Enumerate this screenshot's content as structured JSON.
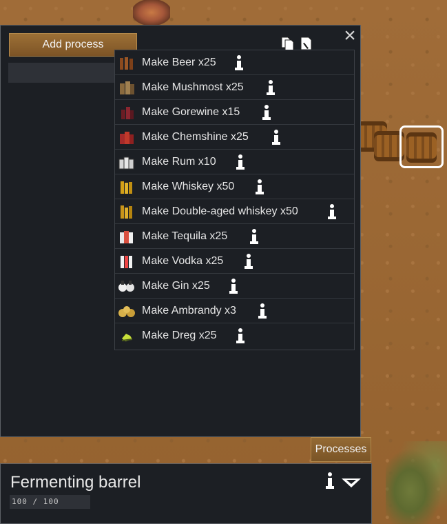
{
  "window": {
    "close_symbol": "×",
    "add_process_label": "Add process",
    "copy_icon": "copy-icon",
    "paste_icon": "paste-icon"
  },
  "menu": {
    "items": [
      {
        "label": "Make Beer x25",
        "icon": "beer-icon"
      },
      {
        "label": "Make Mushmost x25",
        "icon": "mushmost-icon"
      },
      {
        "label": "Make Gorewine x15",
        "icon": "gorewine-icon"
      },
      {
        "label": "Make Chemshine x25",
        "icon": "chemshine-icon"
      },
      {
        "label": "Make Rum x10",
        "icon": "rum-icon"
      },
      {
        "label": "Make Whiskey x50",
        "icon": "whiskey-icon"
      },
      {
        "label": "Make Double-aged whiskey x50",
        "icon": "double-aged-whiskey-icon"
      },
      {
        "label": "Make Tequila x25",
        "icon": "tequila-icon"
      },
      {
        "label": "Make Vodka x25",
        "icon": "vodka-icon"
      },
      {
        "label": "Make Gin x25",
        "icon": "gin-icon"
      },
      {
        "label": "Make Ambrandy x3",
        "icon": "ambrandy-icon"
      },
      {
        "label": "Make Dreg x25",
        "icon": "dreg-icon"
      }
    ],
    "info_icon": "info-icon"
  },
  "tabs": {
    "processes_label": "Processes"
  },
  "inspect": {
    "title": "Fermenting barrel",
    "hit_points": "100 / 100"
  },
  "colors": {
    "panel_bg": "#1c1f24",
    "button_brown": "#8b6230",
    "text": "#e6e6e6"
  }
}
